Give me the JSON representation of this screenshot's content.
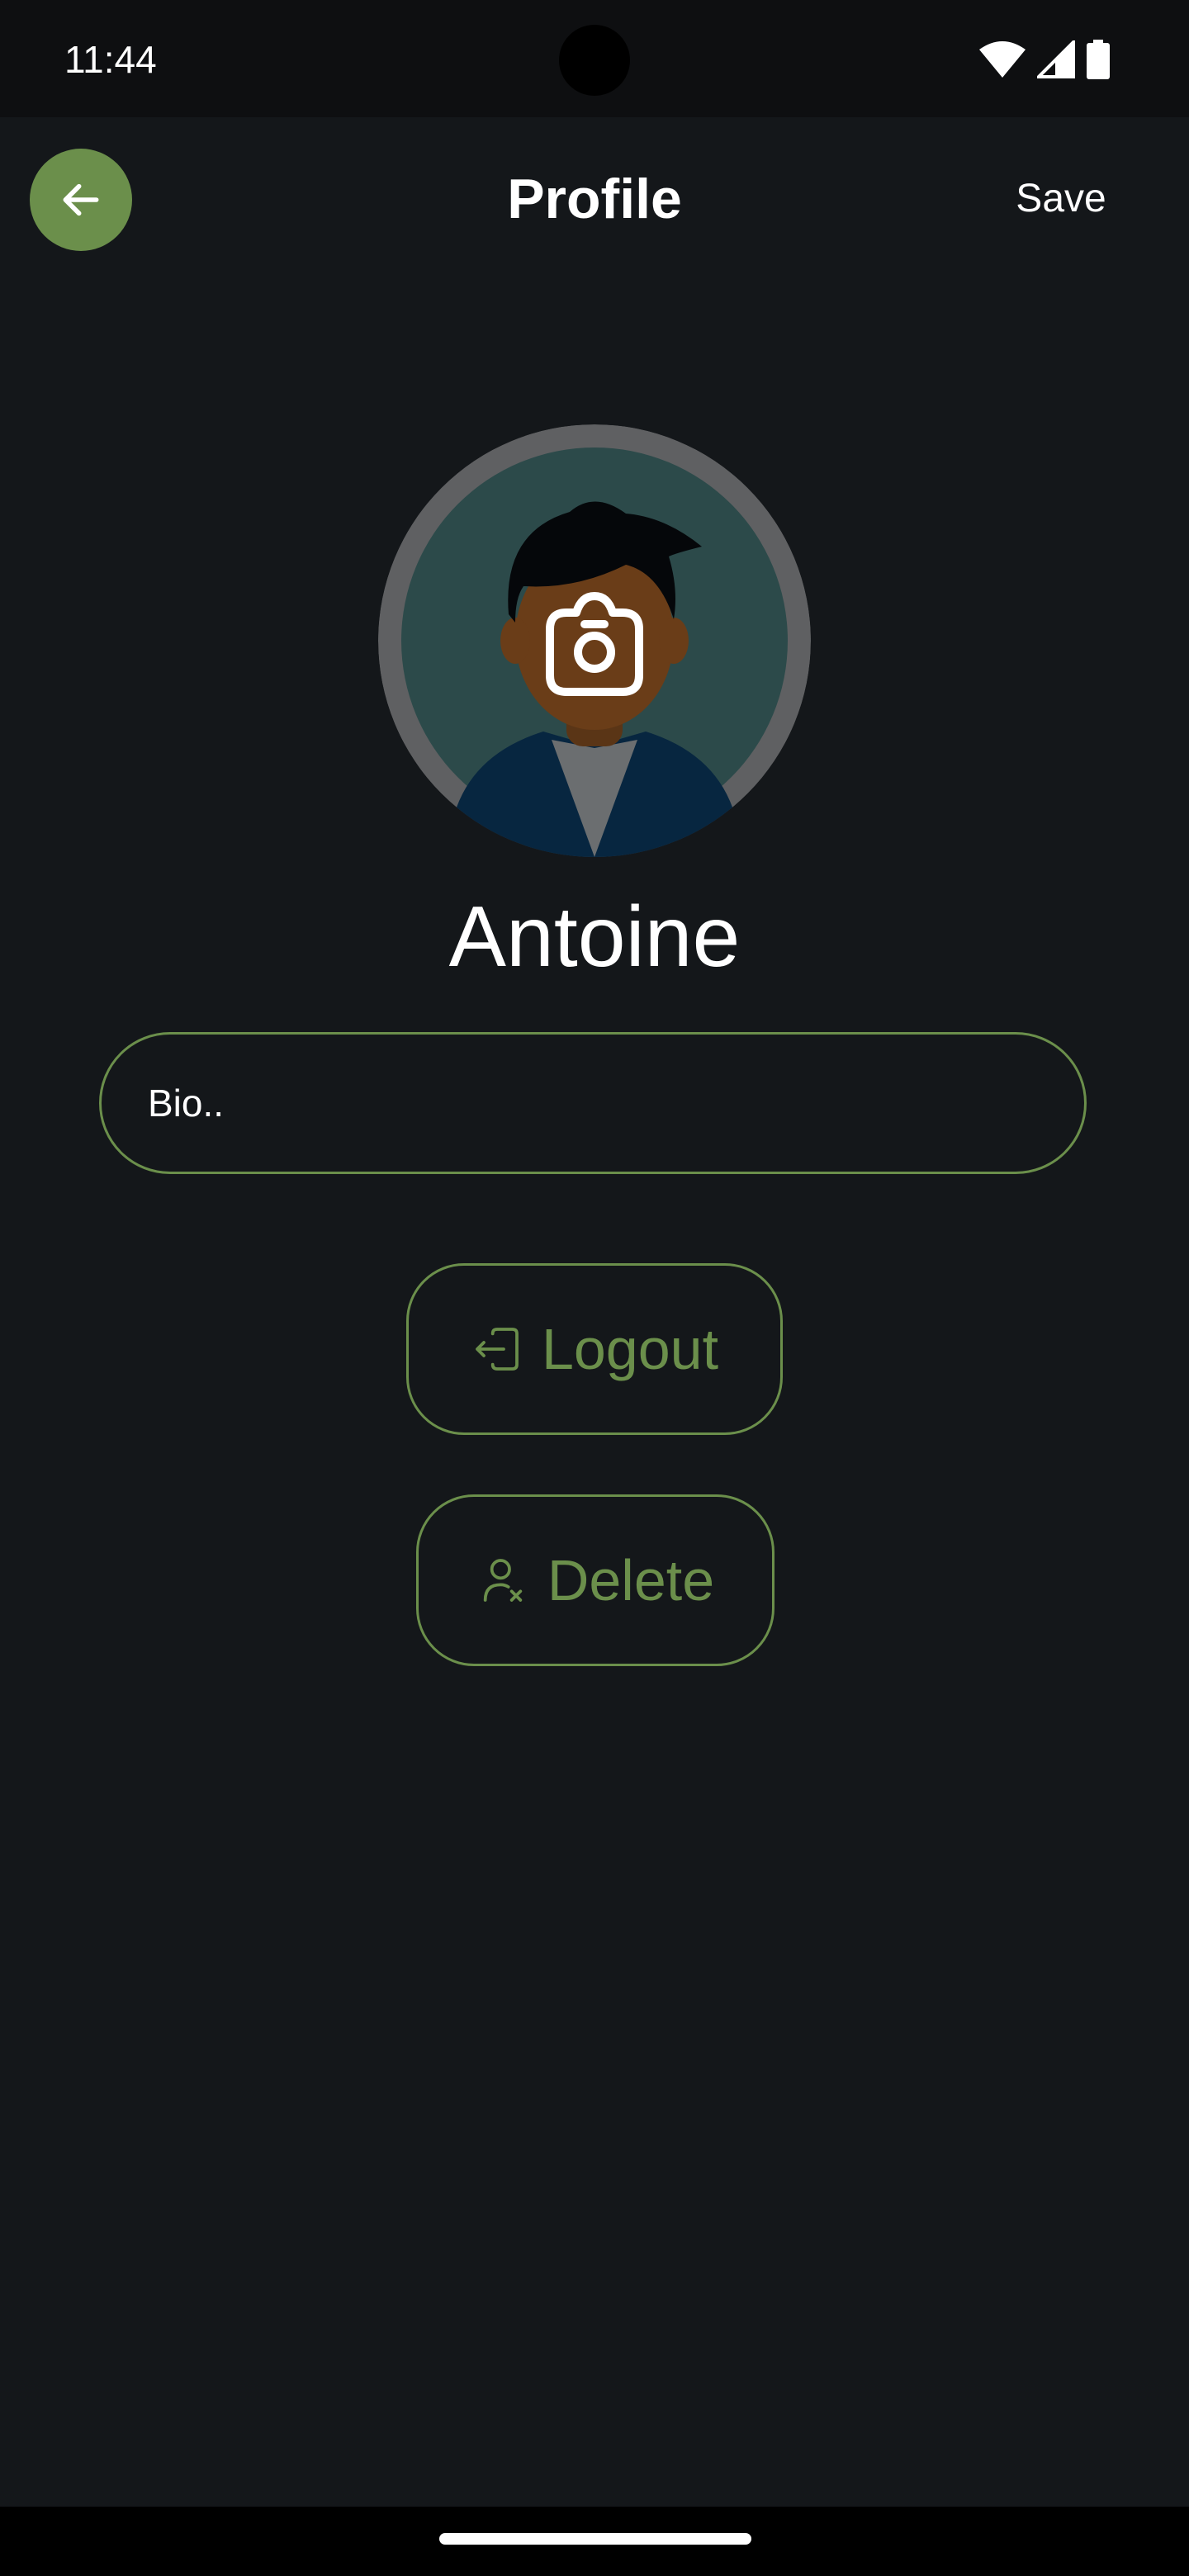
{
  "status_bar": {
    "time": "11:44",
    "icons": [
      "wifi-icon",
      "cellular-signal-icon",
      "battery-icon"
    ]
  },
  "app_bar": {
    "back_icon": "arrow-left-icon",
    "title": "Profile",
    "save_label": "Save"
  },
  "profile": {
    "avatar_icon": "default-avatar",
    "camera_icon": "camera-icon",
    "name": "Antoine"
  },
  "bio": {
    "placeholder": "Bio..",
    "value": ""
  },
  "actions": {
    "logout": {
      "label": "Logout",
      "icon": "logout-icon"
    },
    "delete": {
      "label": "Delete",
      "icon": "user-remove-icon"
    }
  },
  "colors": {
    "background": "#14171a",
    "accent": "#6b8f4b",
    "text": "#ffffff"
  }
}
